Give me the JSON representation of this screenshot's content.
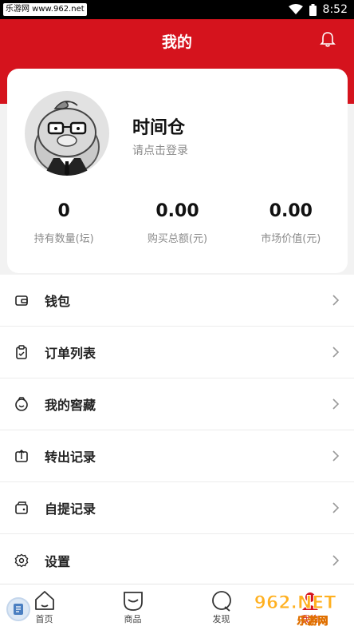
{
  "status_bar": {
    "site_badge": "乐游网 www.962.net",
    "time": "8:52"
  },
  "header": {
    "title": "我的"
  },
  "user": {
    "name": "时间仓",
    "login_prompt": "请点击登录"
  },
  "stats": [
    {
      "value": "0",
      "label": "持有数量(坛)"
    },
    {
      "value": "0.00",
      "label": "购买总额(元)"
    },
    {
      "value": "0.00",
      "label": "市场价值(元)"
    }
  ],
  "menu": [
    {
      "label": "钱包",
      "icon": "wallet-icon"
    },
    {
      "label": "订单列表",
      "icon": "clipboard-icon"
    },
    {
      "label": "我的窖藏",
      "icon": "cellar-icon"
    },
    {
      "label": "转出记录",
      "icon": "transfer-icon"
    },
    {
      "label": "自提记录",
      "icon": "pickup-icon"
    },
    {
      "label": "设置",
      "icon": "gear-icon"
    }
  ],
  "tabs": [
    {
      "label": "首页",
      "icon": "home-icon"
    },
    {
      "label": "商品",
      "icon": "goods-icon"
    },
    {
      "label": "发现",
      "icon": "discover-icon"
    },
    {
      "label": "我的",
      "icon": "profile-icon"
    }
  ],
  "watermark": {
    "text": "962.NET",
    "sub": "乐游网"
  },
  "colors": {
    "brand_red": "#d5131d"
  }
}
